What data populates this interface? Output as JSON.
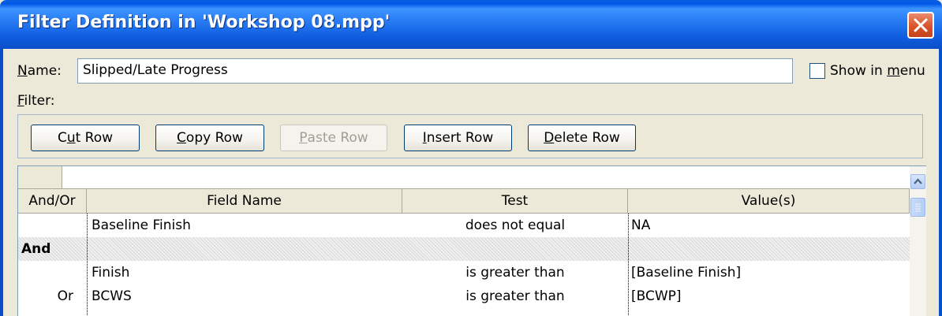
{
  "window": {
    "title": "Filter Definition in 'Workshop 08.mpp'",
    "close_icon": "close-icon"
  },
  "name_field": {
    "label_underlined": "N",
    "label_rest": "ame:",
    "value": "Slipped/Late Progress"
  },
  "show_in_menu": {
    "label_before": "Show in ",
    "label_underlined": "m",
    "label_after": "enu",
    "checked": false
  },
  "filter_label": {
    "underlined": "F",
    "rest": "ilter:"
  },
  "toolbar": {
    "cut_row": {
      "pre": "C",
      "u": "u",
      "post": "t Row",
      "enabled": true
    },
    "copy_row": {
      "pre": "",
      "u": "C",
      "post": "opy Row",
      "enabled": true
    },
    "paste_row": {
      "pre": "",
      "u": "P",
      "post": "aste Row",
      "enabled": false
    },
    "insert_row": {
      "pre": "",
      "u": "I",
      "post": "nsert Row",
      "enabled": true
    },
    "delete_row": {
      "pre": "",
      "u": "D",
      "post": "elete Row",
      "enabled": true
    }
  },
  "grid": {
    "edit_value": "",
    "columns": [
      "And/Or",
      "Field Name",
      "Test",
      "Value(s)"
    ],
    "rows": [
      {
        "and_or": "",
        "field": "Baseline Finish",
        "test": "does not equal",
        "value": "NA",
        "selected": false
      },
      {
        "and_or": "And",
        "field": "",
        "test": "",
        "value": "",
        "selected": true
      },
      {
        "and_or": "",
        "field": "Finish",
        "test": "is greater than",
        "value": "[Baseline Finish]",
        "selected": false
      },
      {
        "and_or": "Or",
        "field": "BCWS",
        "test": "is greater than",
        "value": "[BCWP]",
        "selected": false
      }
    ]
  }
}
